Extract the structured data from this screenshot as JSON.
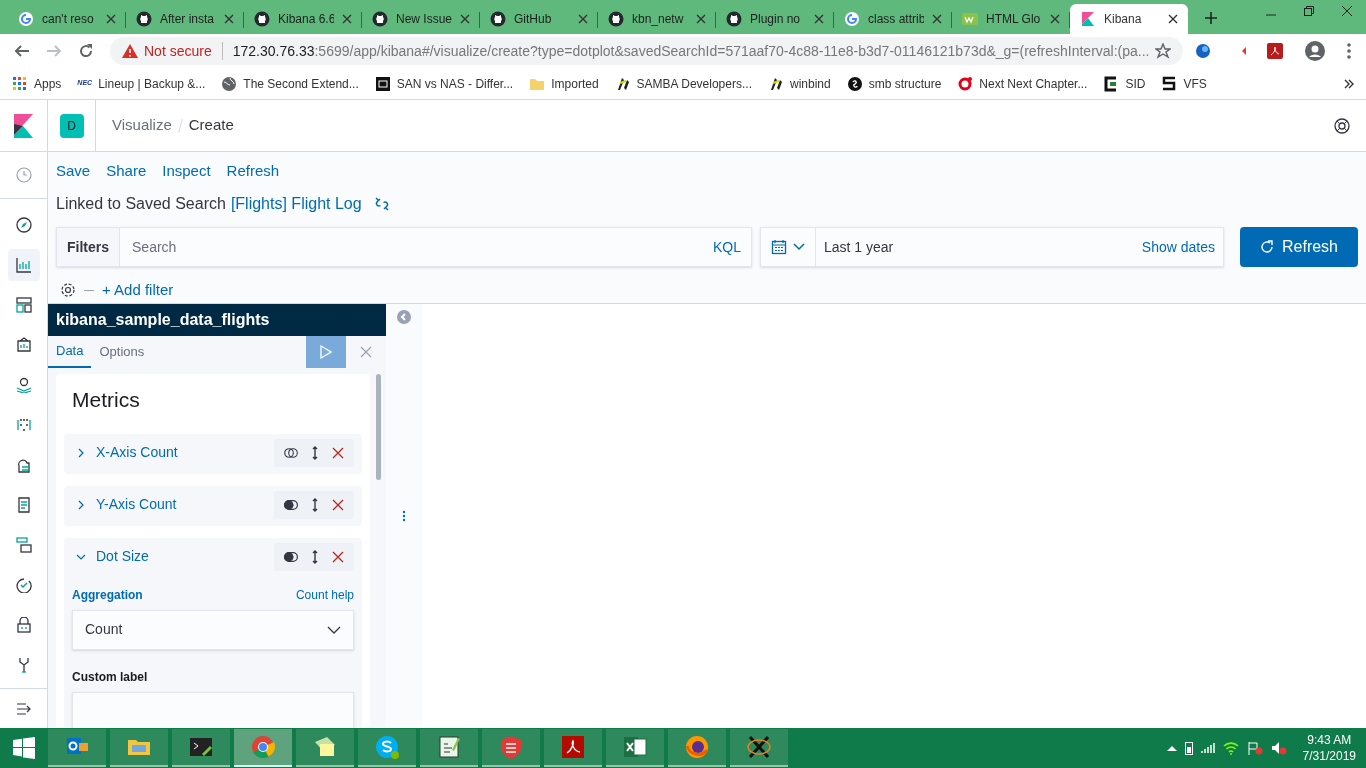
{
  "browser_tabs": [
    {
      "title": "can't reso",
      "kind": "google",
      "selected": false
    },
    {
      "title": "After insta",
      "kind": "github",
      "selected": false
    },
    {
      "title": "Kibana 6.6",
      "kind": "github",
      "selected": false
    },
    {
      "title": "New Issue",
      "kind": "github",
      "selected": false
    },
    {
      "title": "GitHub",
      "kind": "github",
      "selected": false
    },
    {
      "title": "kbn_netw",
      "kind": "github",
      "selected": false
    },
    {
      "title": "Plugin no",
      "kind": "github",
      "selected": false
    },
    {
      "title": "class attrib",
      "kind": "google",
      "selected": false
    },
    {
      "title": "HTML Glo",
      "kind": "w3",
      "selected": false
    },
    {
      "title": "Kibana",
      "kind": "kibana",
      "selected": true
    }
  ],
  "address_bar": {
    "security": "Not secure",
    "host": "172.30.76.33",
    "path": ":5699/app/kibana#/visualize/create?type=dotplot&savedSearchId=571aaf70-4c88-11e8-b3d7-01146121b73d&_g=(refreshInterval:(pa..."
  },
  "bookmarks": [
    {
      "label": "Apps",
      "kind": "apps"
    },
    {
      "label": "Lineup | Backup &...",
      "kind": "logo",
      "badge": "NEC"
    },
    {
      "label": "The Second Extend...",
      "kind": "globe"
    },
    {
      "label": "SAN vs NAS - Differ...",
      "kind": "square"
    },
    {
      "label": "Imported",
      "kind": "folder"
    },
    {
      "label": "SAMBA Developers...",
      "kind": "samba"
    },
    {
      "label": "winbind",
      "kind": "samba"
    },
    {
      "label": "smb structure",
      "kind": "circle"
    },
    {
      "label": "Next Next Chapter...",
      "kind": "ring"
    },
    {
      "label": "SID",
      "kind": "bracket"
    },
    {
      "label": "VFS",
      "kind": "s"
    }
  ],
  "kibana_header": {
    "space": "D",
    "breadcrumbs": [
      "Visualize",
      "Create"
    ]
  },
  "nav": [
    {
      "selected": false
    },
    {
      "selected": true
    },
    {
      "selected": false
    },
    {
      "selected": false
    },
    {
      "selected": false
    },
    {
      "selected": false
    },
    {
      "selected": false
    },
    {
      "selected": false
    },
    {
      "selected": false
    },
    {
      "selected": false
    },
    {
      "selected": false
    },
    {
      "selected": false
    }
  ],
  "top_menu": [
    "Save",
    "Share",
    "Inspect",
    "Refresh"
  ],
  "linked_search": {
    "prefix": "Linked to Saved Search",
    "name": "[Flights] Flight Log"
  },
  "query_bar": {
    "filters_label": "Filters",
    "placeholder": "Search",
    "language": "KQL",
    "time_range": "Last 1 year",
    "show_dates": "Show dates",
    "refresh": "Refresh"
  },
  "add_filter": "+ Add filter",
  "editor": {
    "index_pattern": "kibana_sample_data_flights",
    "tabs": [
      {
        "label": "Data",
        "selected": true
      },
      {
        "label": "Options",
        "selected": false
      }
    ],
    "section": "Metrics",
    "metrics": [
      {
        "label": "X-Axis Count",
        "expanded": false,
        "enabled": false
      },
      {
        "label": "Y-Axis Count",
        "expanded": false,
        "enabled": true
      },
      {
        "label": "Dot Size",
        "expanded": true,
        "enabled": true,
        "aggregation_label": "Aggregation",
        "help": "Count help",
        "aggregation": "Count",
        "custom_label": "Custom label"
      }
    ]
  },
  "taskbar": {
    "apps": [
      {
        "kind": "outlook",
        "selected": false
      },
      {
        "kind": "explorer",
        "selected": false
      },
      {
        "kind": "terminal",
        "selected": false
      },
      {
        "kind": "chrome",
        "selected": true
      },
      {
        "kind": "notes",
        "selected": false
      },
      {
        "kind": "skype",
        "selected": false
      },
      {
        "kind": "notepad",
        "selected": false
      },
      {
        "kind": "shield",
        "selected": false
      },
      {
        "kind": "pdf",
        "selected": false
      },
      {
        "kind": "excel",
        "selected": false
      },
      {
        "kind": "firefox",
        "selected": false
      },
      {
        "kind": "x",
        "selected": false
      }
    ],
    "time": "9:43 AM",
    "date": "7/31/2019"
  }
}
